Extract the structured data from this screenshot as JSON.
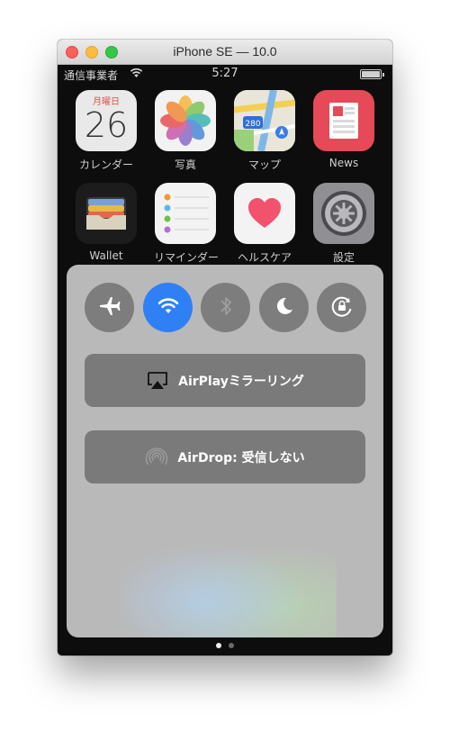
{
  "window": {
    "title": "iPhone SE — 10.0"
  },
  "statusbar": {
    "carrier": "通信事業者",
    "time": "5:27"
  },
  "apps": [
    {
      "label": "カレンダー",
      "icon": "calendar-icon",
      "weekday": "月曜日",
      "day": "26"
    },
    {
      "label": "写真",
      "icon": "photos-icon"
    },
    {
      "label": "マップ",
      "icon": "maps-icon",
      "route": "280"
    },
    {
      "label": "News",
      "icon": "news-icon"
    },
    {
      "label": "Wallet",
      "icon": "wallet-icon"
    },
    {
      "label": "リマインダー",
      "icon": "reminders-icon"
    },
    {
      "label": "ヘルスケア",
      "icon": "health-icon"
    },
    {
      "label": "設定",
      "icon": "settings-icon"
    }
  ],
  "control_center": {
    "toggles": [
      {
        "name": "airplane-mode",
        "icon": "airplane-icon",
        "active": false
      },
      {
        "name": "wifi",
        "icon": "wifi-icon",
        "active": true
      },
      {
        "name": "bluetooth",
        "icon": "bluetooth-icon",
        "active": false
      },
      {
        "name": "do-not-disturb",
        "icon": "moon-icon",
        "active": false
      },
      {
        "name": "rotation-lock",
        "icon": "rotation-lock-icon",
        "active": false
      }
    ],
    "airplay_label": "AirPlayミラーリング",
    "airdrop_label": "AirDrop: 受信しない"
  },
  "colors": {
    "accent": "#2f80f5",
    "toggle_off": "#7d7d7d",
    "panel": "#b9b9b9"
  },
  "pagination": {
    "total": 2,
    "current": 1
  }
}
